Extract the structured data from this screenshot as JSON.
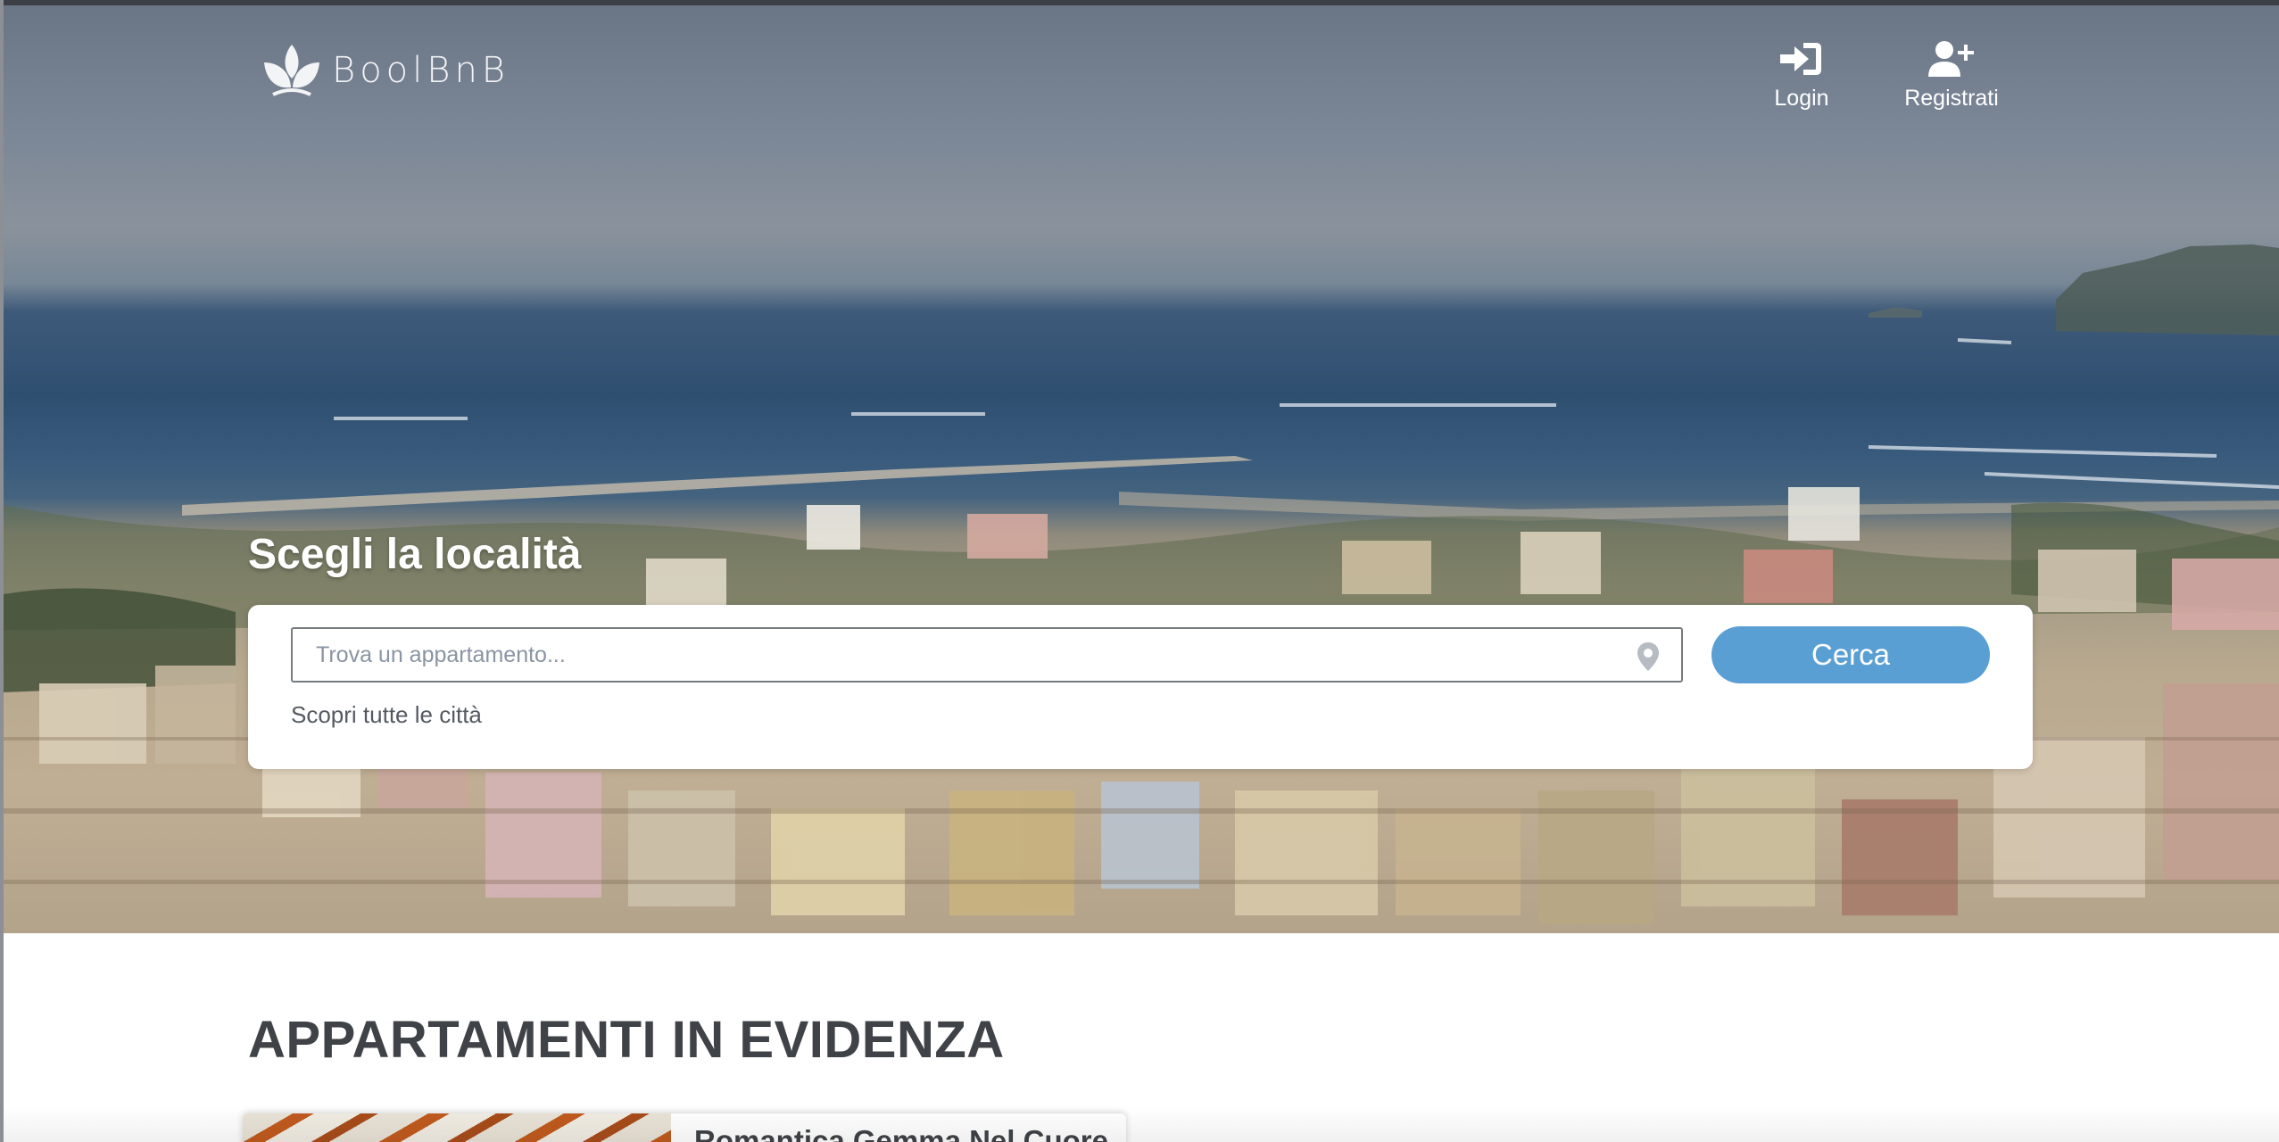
{
  "brand": {
    "name": "BoolBnB",
    "logo_icon": "leaf-logo-icon"
  },
  "nav": {
    "login": {
      "label": "Login",
      "icon": "sign-in-icon"
    },
    "register": {
      "label": "Registrati",
      "icon": "user-plus-icon"
    }
  },
  "search": {
    "title": "Scegli la località",
    "placeholder": "Trova un appartamento...",
    "value": "",
    "location_icon": "map-pin-icon",
    "button_label": "Cerca",
    "cities_link": "Scopri tutte le città"
  },
  "featured": {
    "title": "APPARTAMENTI IN EVIDENZA",
    "cards": [
      {
        "title": "Romantica Gemma Nel Cuore"
      }
    ]
  },
  "colors": {
    "accent": "#5a9fd4",
    "heading": "#3f4246",
    "card_background": "#ffffff"
  }
}
